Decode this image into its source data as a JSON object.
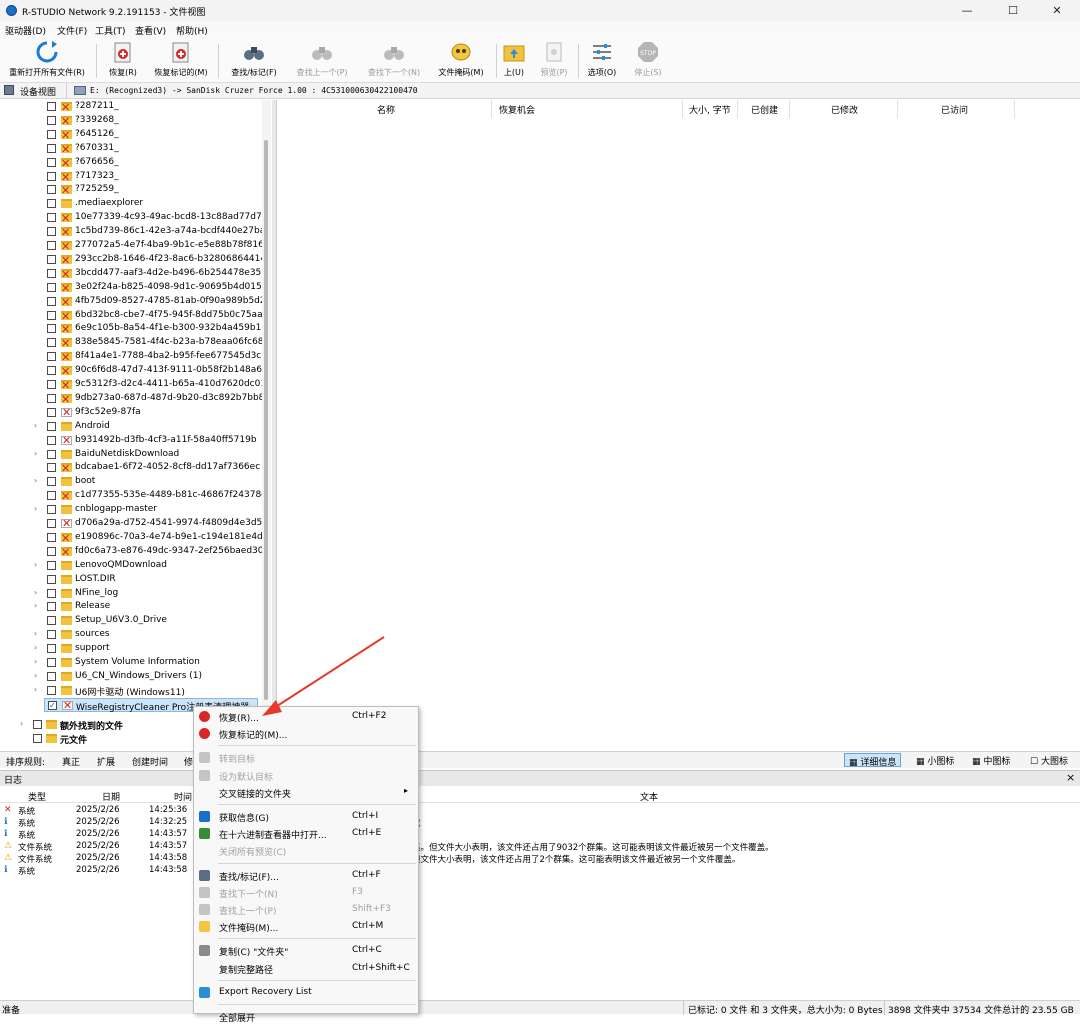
{
  "window": {
    "title": "R-STUDIO Network 9.2.191153 - 文件视图",
    "minimize": "—",
    "maximize": "☐",
    "close": "✕"
  },
  "menu": [
    "驱动器(D)",
    "文件(F)",
    "工具(T)",
    "查看(V)",
    "帮助(H)"
  ],
  "toolbar": {
    "reopen": "重新打开所有文件(R)",
    "recover": "恢复(R)",
    "recover_marked": "恢复标记的(M)",
    "find_mark": "查找/标记(F)",
    "find_prev": "查找上一个(P)",
    "find_next": "查找下一个(N)",
    "file_mask": "文件掩码(M)",
    "up": "上(U)",
    "preview": "预览(P)",
    "options": "选项(O)",
    "stop": "停止(S)",
    "stop_icon_text": "STOP"
  },
  "pathbar": {
    "device_view": "设备视图",
    "path": "E: (Recognized3) -> SanDisk Cruzer Force 1.00 : 4C531000630422100470"
  },
  "tree": {
    "items": [
      {
        "label": "?287211_",
        "type": "deleted-folder"
      },
      {
        "label": "?339268_",
        "type": "deleted-folder"
      },
      {
        "label": "?645126_",
        "type": "deleted-folder"
      },
      {
        "label": "?670331_",
        "type": "deleted-folder"
      },
      {
        "label": "?676656_",
        "type": "deleted-folder"
      },
      {
        "label": "?717323_",
        "type": "deleted-folder"
      },
      {
        "label": "?725259_",
        "type": "deleted-folder"
      },
      {
        "label": ".mediaexplorer",
        "type": "folder"
      },
      {
        "label": "10e77339-4c93-49ac-bcd8-13c88ad77d7b",
        "type": "deleted-folder"
      },
      {
        "label": "1c5bd739-86c1-42e3-a74a-bcdf440e27ba",
        "type": "deleted-folder"
      },
      {
        "label": "277072a5-4e7f-4ba9-9b1c-e5e88b78f816",
        "type": "deleted-folder"
      },
      {
        "label": "293cc2b8-1646-4f23-8ac6-b32806864414",
        "type": "deleted-folder"
      },
      {
        "label": "3bcdd477-aaf3-4d2e-b496-6b254478e355",
        "type": "deleted-folder"
      },
      {
        "label": "3e02f24a-b825-4098-9d1c-90695b4d0159",
        "type": "deleted-folder"
      },
      {
        "label": "4fb75d09-8527-4785-81ab-0f90a989b5d2",
        "type": "deleted-folder"
      },
      {
        "label": "6bd32bc8-cbe7-4f75-945f-8dd75b0c75aa",
        "type": "deleted-folder"
      },
      {
        "label": "6e9c105b-8a54-4f1e-b300-932b4a459b11",
        "type": "deleted-folder"
      },
      {
        "label": "838e5845-7581-4f4c-b23a-b78eaa06fc68",
        "type": "deleted-folder"
      },
      {
        "label": "8f41a4e1-7788-4ba2-b95f-fee677545d3c",
        "type": "deleted-folder"
      },
      {
        "label": "90c6f6d8-47d7-413f-9111-0b58f2b148a6",
        "type": "deleted-folder"
      },
      {
        "label": "9c5312f3-d2c4-4411-b65a-410d7620dc01",
        "type": "deleted-folder"
      },
      {
        "label": "9db273a0-687d-487d-9b20-d3c892b7bb87",
        "type": "deleted-folder"
      },
      {
        "label": "9f3c52e9-87fa",
        "type": "deleted-file"
      },
      {
        "label": "Android",
        "type": "folder",
        "expand": true
      },
      {
        "label": "b931492b-d3fb-4cf3-a11f-58a40ff5719b",
        "type": "deleted-file"
      },
      {
        "label": "BaiduNetdiskDownload",
        "type": "folder",
        "expand": true
      },
      {
        "label": "bdcabae1-6f72-4052-8cf8-dd17af7366ec",
        "type": "deleted-folder"
      },
      {
        "label": "boot",
        "type": "folder",
        "expand": true
      },
      {
        "label": "c1d77355-535e-4489-b81c-46867f24378c",
        "type": "deleted-folder"
      },
      {
        "label": "cnblogapp-master",
        "type": "folder",
        "expand": true
      },
      {
        "label": "d706a29a-d752-4541-9974-f4809d4e3d56",
        "type": "deleted-file"
      },
      {
        "label": "e190896c-70a3-4e74-b9e1-c194e181e4d4",
        "type": "deleted-folder"
      },
      {
        "label": "fd0c6a73-e876-49dc-9347-2ef256baed30",
        "type": "deleted-folder"
      },
      {
        "label": "LenovoQMDownload",
        "type": "folder",
        "expand": true
      },
      {
        "label": "LOST.DIR",
        "type": "folder"
      },
      {
        "label": "NFine_log",
        "type": "folder",
        "expand": true
      },
      {
        "label": "Release",
        "type": "folder",
        "expand": true
      },
      {
        "label": "Setup_U6V3.0_Drive",
        "type": "folder"
      },
      {
        "label": "sources",
        "type": "folder",
        "expand": true
      },
      {
        "label": "support",
        "type": "folder",
        "expand": true
      },
      {
        "label": "System Volume Information",
        "type": "folder",
        "expand": true
      },
      {
        "label": "U6_CN_Windows_Drivers (1)",
        "type": "folder",
        "expand": true
      },
      {
        "label": "U6网卡驱动 (Windows11)",
        "type": "folder",
        "expand": true
      },
      {
        "label": "WiseRegistryCleaner Pro注册表清理神器",
        "type": "deleted-file",
        "checked": true,
        "selected": true
      }
    ],
    "extra": "额外找到的文件",
    "meta": "元文件"
  },
  "list_headers": [
    "名称",
    "恢复机会",
    "大小, 字节",
    "已创建",
    "已修改",
    "已访问"
  ],
  "sortbar": {
    "label": "排序规则:",
    "items": [
      "真正",
      "扩展",
      "创建时间",
      "修"
    ],
    "views": [
      "详细信息",
      "小图标",
      "中图标",
      "大图标"
    ]
  },
  "log": {
    "title": "日志",
    "close": "×",
    "headers": [
      "类型",
      "日期",
      "时间",
      "文本"
    ],
    "rows": [
      {
        "type": "系统",
        "date": "2025/2/26",
        "time": "14:25:36",
        "text": "",
        "icon": "error"
      },
      {
        "type": "系统",
        "date": "2025/2/26",
        "time": "14:32:25",
        "text": "成",
        "icon": "info"
      },
      {
        "type": "系统",
        "date": "2025/2/26",
        "time": "14:43:57",
        "text": "",
        "icon": "info"
      },
      {
        "type": "文件系统",
        "date": "2025/2/26",
        "time": "14:43:57",
        "text": "集。但文件大小表明，该文件还占用了9032个群集。这可能表明该文件最近被另一个文件覆盖。",
        "icon": "warn"
      },
      {
        "type": "文件系统",
        "date": "2025/2/26",
        "time": "14:43:58",
        "text": "但文件大小表明，该文件还占用了2个群集。这可能表明该文件最近被另一个文件覆盖。",
        "icon": "warn"
      },
      {
        "type": "系统",
        "date": "2025/2/26",
        "time": "14:43:58",
        "text": "",
        "icon": "info"
      }
    ]
  },
  "status": {
    "left": "准备",
    "marked": "已标记: 0 文件 和 3 文件夹，总大小为: 0 Bytes",
    "total": "3898 文件夹中 37534 文件总计的 23.55 GB"
  },
  "context_menu": [
    {
      "label": "恢复(R)...",
      "shortcut": "Ctrl+F2",
      "icon": "recover"
    },
    {
      "label": "恢复标记的(M)...",
      "shortcut": "",
      "icon": "recover"
    },
    {
      "sep": true
    },
    {
      "label": "转到目标",
      "shortcut": "",
      "disabled": true,
      "icon": "gray"
    },
    {
      "label": "设为默认目标",
      "shortcut": "",
      "disabled": true,
      "icon": "gray"
    },
    {
      "label": "交叉链接的文件夹",
      "shortcut": "",
      "submenu": true
    },
    {
      "sep": true
    },
    {
      "label": "获取信息(G)",
      "shortcut": "Ctrl+I",
      "icon": "info"
    },
    {
      "label": "在十六进制查看器中打开...",
      "shortcut": "Ctrl+E",
      "icon": "hex"
    },
    {
      "label": "关闭所有预览(C)",
      "shortcut": "",
      "disabled": true
    },
    {
      "sep": true
    },
    {
      "label": "查找/标记(F)...",
      "shortcut": "Ctrl+F",
      "icon": "find"
    },
    {
      "label": "查找下一个(N)",
      "shortcut": "F3",
      "disabled": true,
      "icon": "gray"
    },
    {
      "label": "查找上一个(P)",
      "shortcut": "Shift+F3",
      "disabled": true,
      "icon": "gray"
    },
    {
      "label": "文件掩码(M)...",
      "shortcut": "Ctrl+M",
      "icon": "mask"
    },
    {
      "sep": true
    },
    {
      "label": "复制(C) \"文件夹\"",
      "shortcut": "Ctrl+C",
      "icon": "copy"
    },
    {
      "label": "复制完整路径",
      "shortcut": "Ctrl+Shift+C"
    },
    {
      "sep": true
    },
    {
      "label": "Export Recovery List",
      "shortcut": "",
      "icon": "export"
    },
    {
      "sep": true
    },
    {
      "label": "全部展开",
      "shortcut": ""
    }
  ],
  "colors": {
    "accent": "#1a6fc9",
    "folder": "#f3c23c",
    "deleted": "#d21f1f",
    "arrow": "#e23b2a",
    "selected": "#cce4f7"
  }
}
